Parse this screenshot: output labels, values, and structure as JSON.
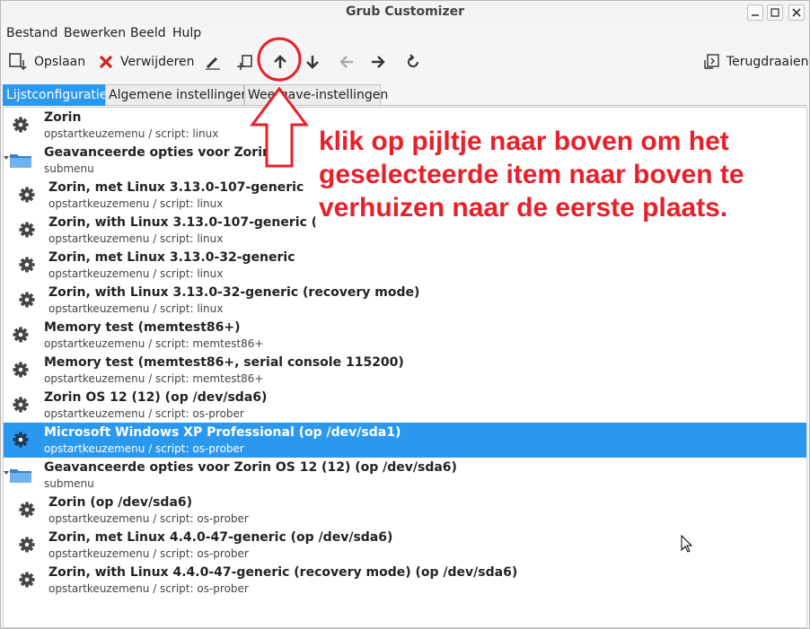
{
  "window": {
    "title": "Grub Customizer"
  },
  "menu": [
    "Bestand",
    "Bewerken",
    "Beeld",
    "Hulp"
  ],
  "toolbar": {
    "save_label": "Opslaan",
    "delete_label": "Verwijderen",
    "revert_label": "Terugdraaien"
  },
  "tabs": [
    "Lijstconfiguratie",
    "Algemene instellingen",
    "Weergave-instellingen"
  ],
  "entries": [
    {
      "title": "Zorin",
      "subtitle": "opstartkeuzemenu / script: linux"
    },
    {
      "title": "Geavanceerde opties voor Zorin",
      "subtitle": "submenu"
    },
    {
      "title": "Zorin, met Linux 3.13.0-107-generic",
      "subtitle": "opstartkeuzemenu / script: linux"
    },
    {
      "title": "Zorin, with Linux 3.13.0-107-generic (recovery mode)",
      "subtitle": "opstartkeuzemenu / script: linux"
    },
    {
      "title": "Zorin, met Linux 3.13.0-32-generic",
      "subtitle": "opstartkeuzemenu / script: linux"
    },
    {
      "title": "Zorin, with Linux 3.13.0-32-generic (recovery mode)",
      "subtitle": "opstartkeuzemenu / script: linux"
    },
    {
      "title": "Memory test (memtest86+)",
      "subtitle": "opstartkeuzemenu / script: memtest86+"
    },
    {
      "title": "Memory test (memtest86+, serial console 115200)",
      "subtitle": "opstartkeuzemenu / script: memtest86+"
    },
    {
      "title": "Zorin OS 12 (12) (op /dev/sda6)",
      "subtitle": "opstartkeuzemenu / script: os-prober"
    },
    {
      "title": "Microsoft Windows XP Professional (op /dev/sda1)",
      "subtitle": "opstartkeuzemenu / script: os-prober"
    },
    {
      "title": "Geavanceerde opties voor Zorin OS 12 (12) (op /dev/sda6)",
      "subtitle": "submenu"
    },
    {
      "title": "Zorin (op /dev/sda6)",
      "subtitle": "opstartkeuzemenu / script: os-prober"
    },
    {
      "title": "Zorin, met Linux 4.4.0-47-generic (op /dev/sda6)",
      "subtitle": "opstartkeuzemenu / script: os-prober"
    },
    {
      "title": "Zorin, with Linux 4.4.0-47-generic (recovery mode) (op /dev/sda6)",
      "subtitle": "opstartkeuzemenu / script: os-prober"
    }
  ],
  "annotation": {
    "text": "klik op pijltje naar boven om het geselecteerde item naar boven te verhuizen naar de eerste plaats."
  },
  "colors": {
    "selection": "#2b98f0",
    "annotation": "#e8202a"
  }
}
